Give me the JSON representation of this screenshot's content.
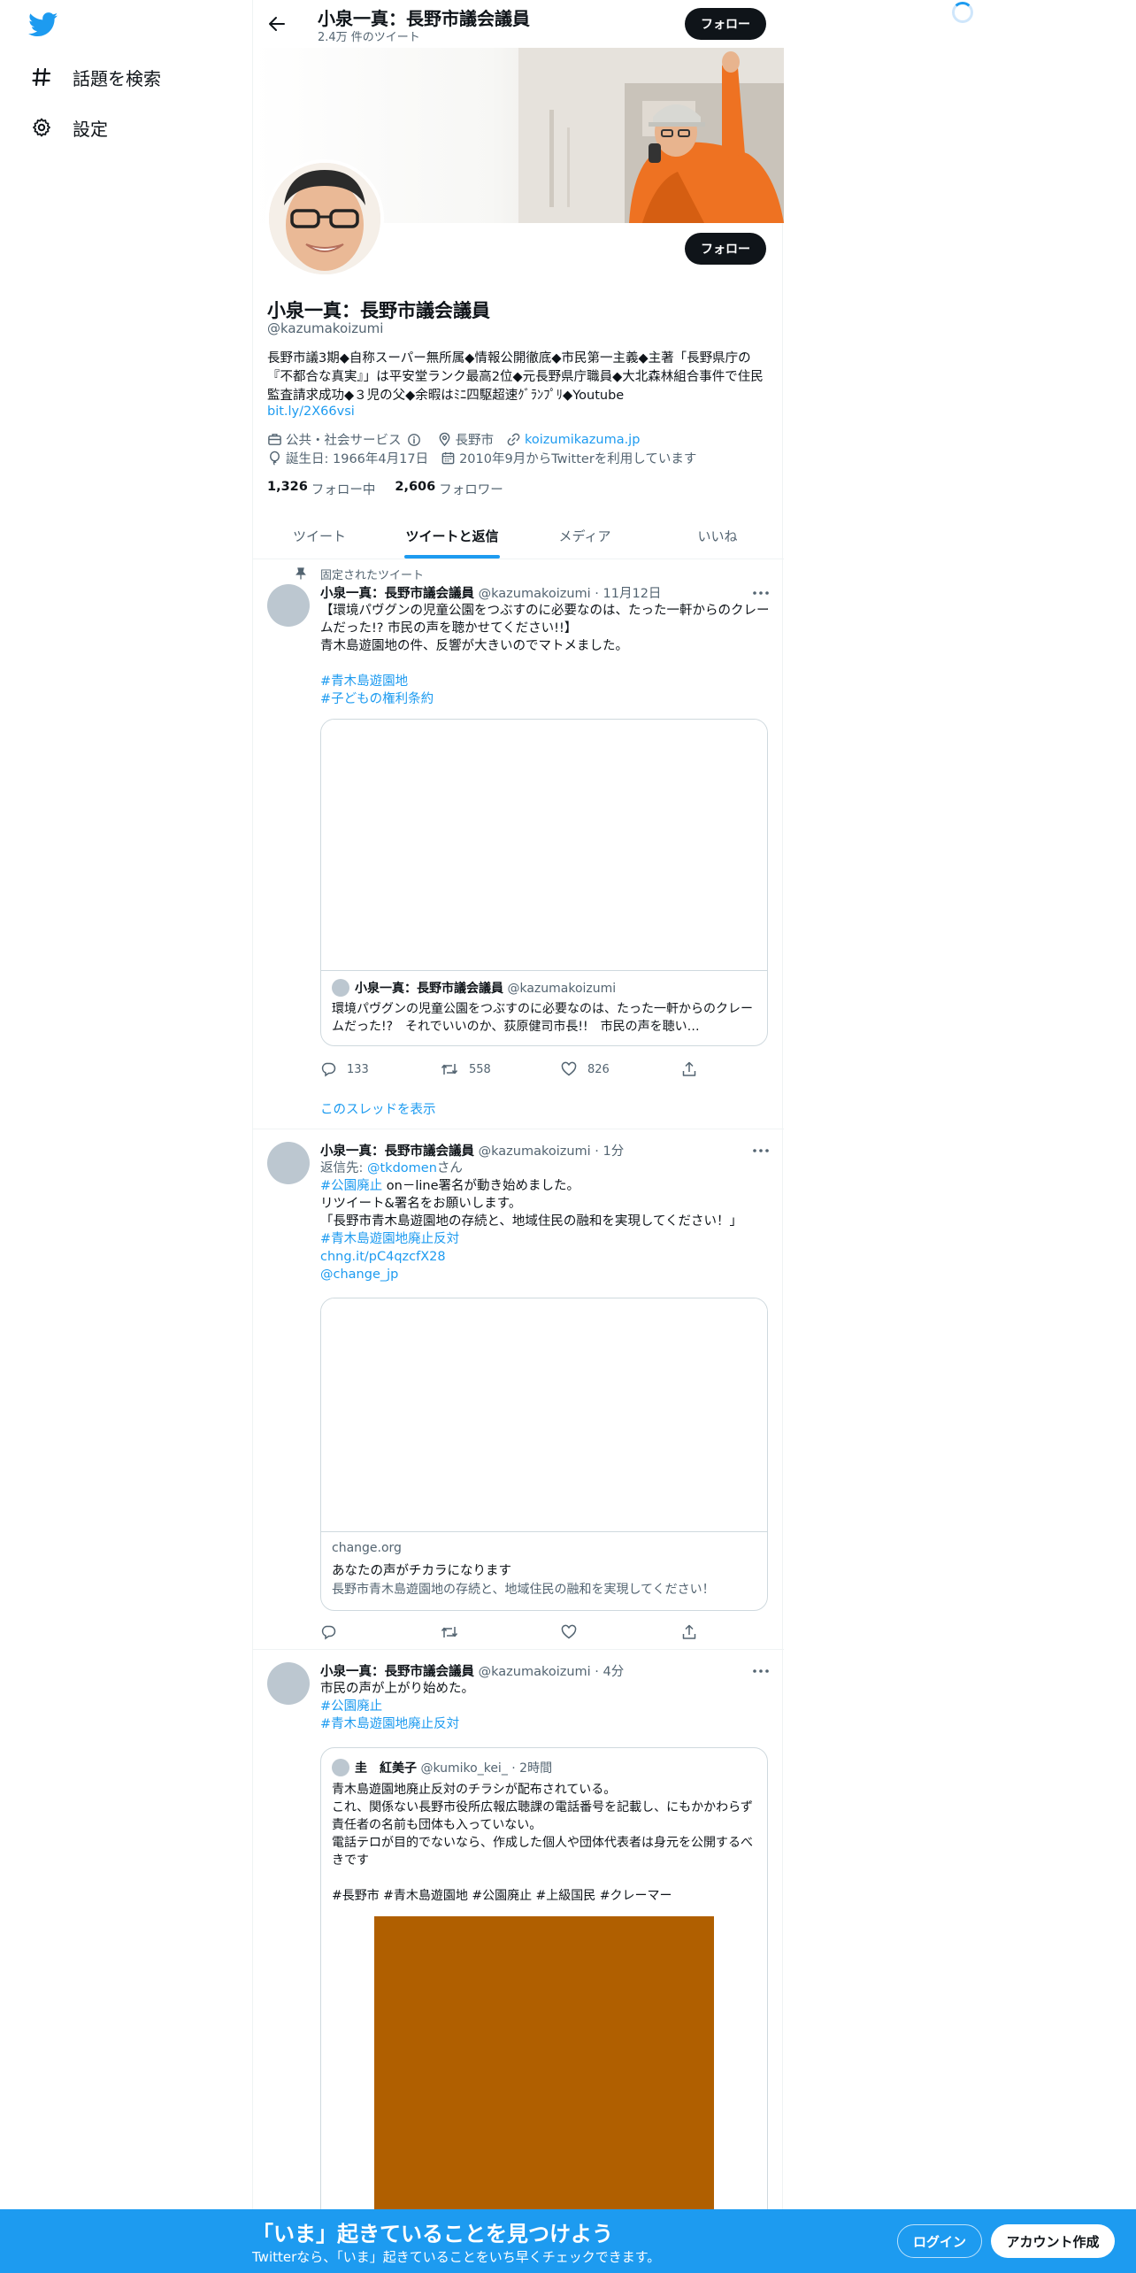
{
  "nav": {
    "explore_label": "話題を検索",
    "settings_label": "設定"
  },
  "header": {
    "title": "小泉一真：長野市議会議員",
    "tweet_count": "2.4万 件のツイート",
    "follow_label": "フォロー"
  },
  "profile": {
    "name": "小泉一真：長野市議会議員",
    "handle": "@kazumakoizumi",
    "follow_label": "フォロー",
    "bio": "長野市議3期◆自称スーパー無所属◆情報公開徹底◆市民第一主義◆主著「長野県庁の『不都合な真実』」は平安堂ランク最高2位◆元長野県庁職員◆大北森林組合事件で住民監査請求成功◆３児の父◆余暇はﾐﾆ四駆超速ｸﾞﾗﾝﾌﾟﾘ◆Youtube",
    "bio_link": "bit.ly/2X66vsi",
    "category": "公共・社会サービス",
    "location": "長野市",
    "website": "koizumikazuma.jp",
    "birthday": "誕生日: 1966年4月17日",
    "joined": "2010年9月からTwitterを利用しています",
    "following_count": "1,326",
    "following_label": "フォロー中",
    "followers_count": "2,606",
    "followers_label": "フォロワー"
  },
  "tabs": [
    "ツイート",
    "ツイートと返信",
    "メディア",
    "いいね"
  ],
  "tweets": [
    {
      "pinned_label": "固定されたツイート",
      "name": "小泉一真：長野市議会議員",
      "handle": "@kazumakoizumi",
      "time": "· 11月12日",
      "line1": "【環境パヴグンの児童公園をつぶすのに必要なのは、たった一軒からのクレームだった!? 市民の声を聴かせてください!!】",
      "line2": "青木島遊園地の件、反響が大きいのでマトメました。",
      "tag1": "#青木島遊園地",
      "tag2": "#子どもの権利条約",
      "card_name": "小泉一真：長野市議会議員",
      "card_handle": "@kazumakoizumi",
      "card_text": "環境パヴグンの児童公園をつぶすのに必要なのは、たった一軒からのクレームだった!?　それでいいのか、荻原健司市長!!　市民の声を聴い…",
      "replies": "133",
      "retweets": "558",
      "likes": "826",
      "thread_link": "このスレッドを表示"
    },
    {
      "name": "小泉一真：長野市議会議員",
      "handle": "@kazumakoizumi",
      "time": "· 1分",
      "reply_prefix": "返信先: ",
      "reply_to": "@tkdomen",
      "reply_suffix": "さん",
      "tag1": "#公園廃止",
      "line1": " on－line署名が動き始めました。",
      "line2": "リツイート&署名をお願いします。",
      "line3": "「長野市青木島遊園地の存続と、地域住民の融和を実現してください！」",
      "tag2": "#青木島遊園地廃止反対",
      "link1": "chng.it/pC4qzcfX28",
      "link2": "@change_jp",
      "card_domain": "change.org",
      "card_title": "あなたの声がチカラになります",
      "card_desc": "長野市青木島遊園地の存続と、地域住民の融和を実現してください！"
    },
    {
      "name": "小泉一真：長野市議会議員",
      "handle": "@kazumakoizumi",
      "time": "· 4分",
      "line1": "市民の声が上がり始めた。",
      "tag1": "#公園廃止",
      "tag2": "#青木島遊園地廃止反対",
      "quote_name": "圭　紅美子",
      "quote_handle": "@kumiko_kei_",
      "quote_time": "· 2時間",
      "quote_line1": "青木島遊園地廃止反対のチラシが配布されている。",
      "quote_line2": "これ、関係ない長野市役所広報広聴課の電話番号を記載し、にもかかわらず責任者の名前も団体も入っていない。",
      "quote_line3": "電話テロが目的でないなら、作成した個人や団体代表者は身元を公開するべきです",
      "quote_tags": "#長野市 #青木島遊園地 #公園廃止 #上級国民 #クレーマー",
      "quote_image_color": "#b05f00"
    }
  ],
  "bottom_bar": {
    "title": "「いま」起きていることを見つけよう",
    "subtitle": "Twitterなら、「いま」起きていることをいち早くチェックできます。",
    "login_label": "ログイン",
    "signup_label": "アカウント作成"
  },
  "colors": {
    "accent": "#1d9bf0",
    "text": "#0f1419",
    "secondary": "#536471"
  }
}
